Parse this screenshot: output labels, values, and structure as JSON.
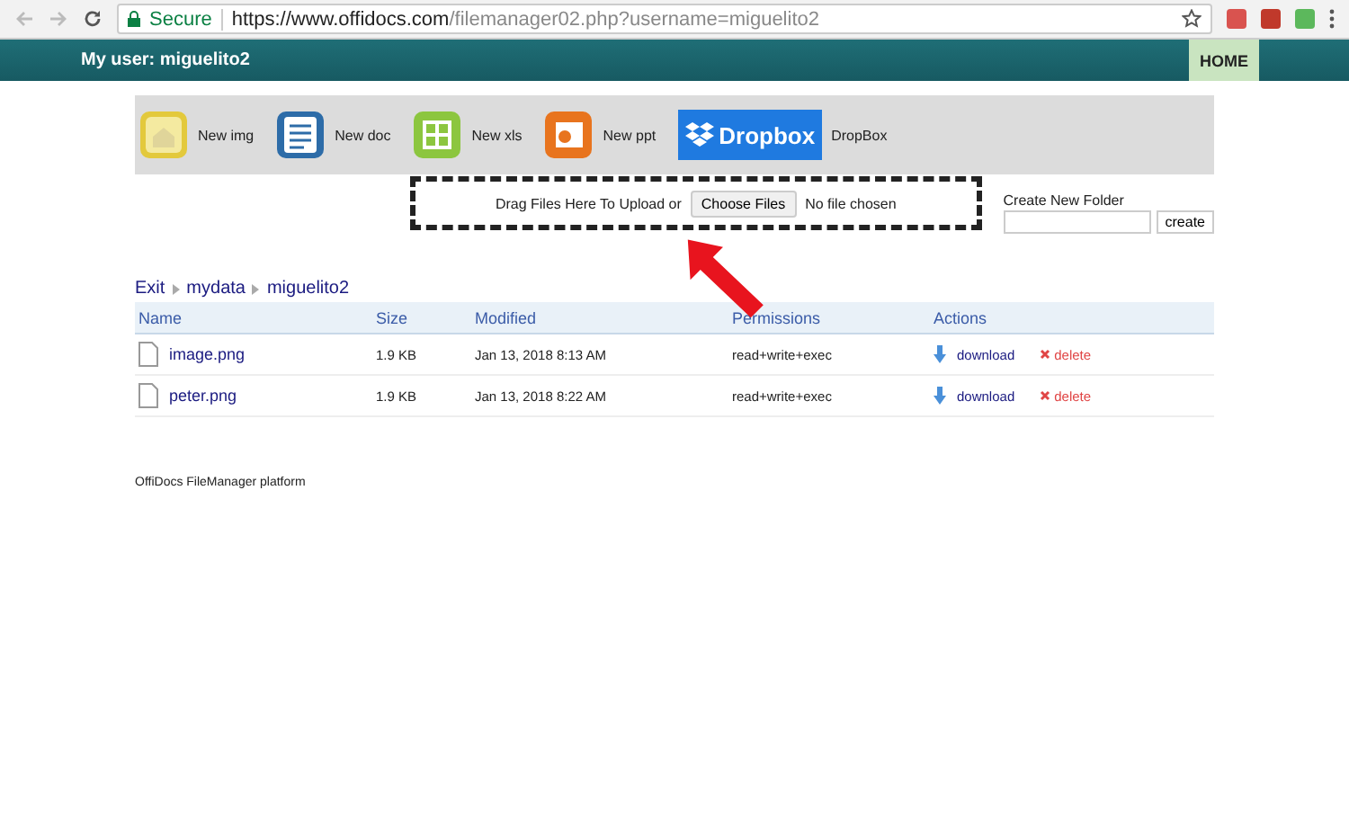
{
  "browser": {
    "secure_label": "Secure",
    "url_host": "https://www.offidocs.com",
    "url_path": "/filemanager02.php?username=miguelito2"
  },
  "header": {
    "user": "My user: miguelito2",
    "home": "HOME"
  },
  "toolbar": [
    {
      "kind": "img",
      "label": "New img"
    },
    {
      "kind": "doc",
      "label": "New doc"
    },
    {
      "kind": "xls",
      "label": "New xls"
    },
    {
      "kind": "ppt",
      "label": "New ppt"
    },
    {
      "kind": "dropbox",
      "logo": "Dropbox",
      "label": "DropBox"
    }
  ],
  "upload": {
    "prompt": "Drag Files Here To Upload or",
    "button": "Choose Files",
    "status": "No file chosen"
  },
  "new_folder": {
    "label": "Create New Folder",
    "button": "create"
  },
  "breadcrumb": [
    "Exit",
    "mydata",
    "miguelito2"
  ],
  "table": {
    "columns": [
      "Name",
      "Size",
      "Modified",
      "Permissions",
      "Actions"
    ],
    "rows": [
      {
        "name": "image.png",
        "size": "1.9 KB",
        "modified": "Jan 13, 2018 8:13 AM",
        "permissions": "read+write+exec",
        "download": "download",
        "delete": "delete"
      },
      {
        "name": "peter.png",
        "size": "1.9 KB",
        "modified": "Jan 13, 2018 8:22 AM",
        "permissions": "read+write+exec",
        "download": "download",
        "delete": "delete"
      }
    ]
  },
  "footer": "OffiDocs FileManager platform"
}
